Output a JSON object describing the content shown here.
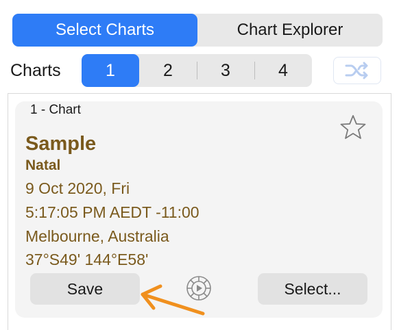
{
  "top_segment": {
    "options": [
      {
        "label": "Select Charts",
        "active": true
      },
      {
        "label": "Chart Explorer",
        "active": false
      }
    ]
  },
  "charts_row": {
    "label": "Charts",
    "numbers": [
      "1",
      "2",
      "3",
      "4"
    ],
    "active_index": 0
  },
  "card": {
    "title": "1 - Chart",
    "name": "Sample",
    "chart_type": "Natal",
    "date": "9 Oct 2020, Fri",
    "time": "5:17:05 PM AEDT -11:00",
    "place": "Melbourne, Australia",
    "coords": "37°S49' 144°E58'",
    "save_label": "Save",
    "select_label": "Select..."
  },
  "colors": {
    "accent": "#2e7cf6",
    "info_text": "#7a5a1d",
    "annotation_arrow": "#f0901e"
  },
  "icons": {
    "shuffle": "shuffle-icon",
    "star": "star-icon",
    "play": "play-wheel-icon"
  }
}
